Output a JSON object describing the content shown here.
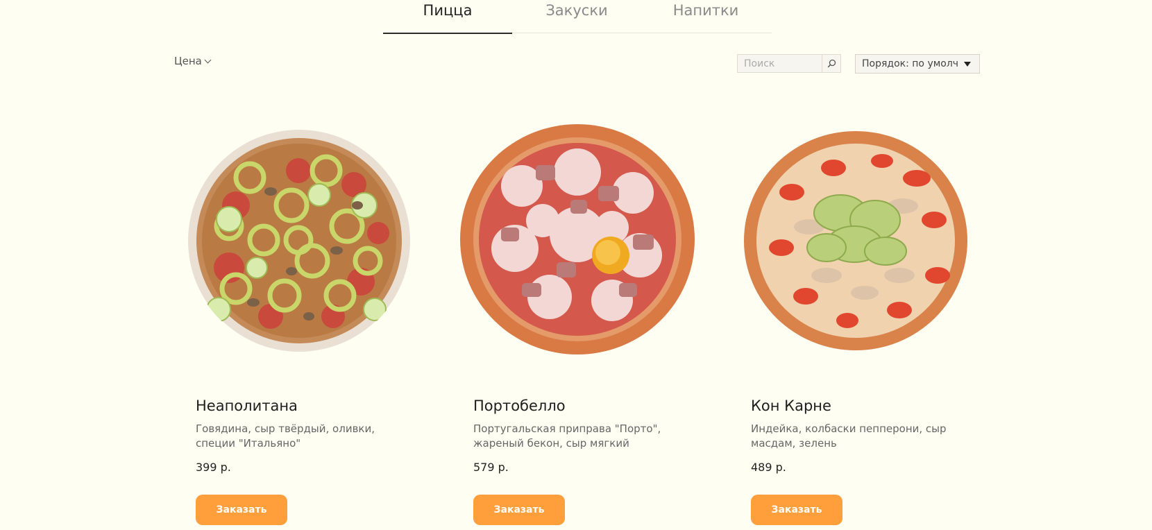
{
  "tabs": [
    {
      "label": "Пицца",
      "active": true
    },
    {
      "label": "Закуски",
      "active": false
    },
    {
      "label": "Напитки",
      "active": false
    }
  ],
  "filters": {
    "price_label": "Цена",
    "search_placeholder": "Поиск",
    "search_value": "",
    "sort_label": "Порядок: по умолчанию"
  },
  "products": [
    {
      "name": "Неаполитана",
      "description": "Говядина, сыр твёрдый, оливки, специи \"Итальяно\"",
      "price": "399 р.",
      "button": "Заказать"
    },
    {
      "name": "Портобелло",
      "description": "Португальская приправа \"Порто\", жареный бекон, сыр мягкий",
      "price": "579 р.",
      "button": "Заказать"
    },
    {
      "name": "Кон Карне",
      "description": "Индейка, колбаски пепперони, сыр масдам, зелень",
      "price": "489 р.",
      "button": "Заказать"
    }
  ],
  "colors": {
    "background": "#fffef2",
    "accent": "#ff9f3b",
    "tab_active_line": "#2c2c2c"
  }
}
